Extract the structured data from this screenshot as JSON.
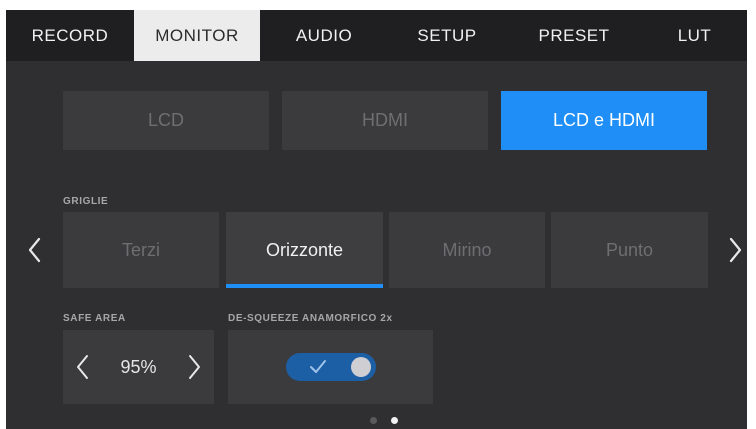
{
  "tabs": [
    {
      "label": "RECORD"
    },
    {
      "label": "MONITOR"
    },
    {
      "label": "AUDIO"
    },
    {
      "label": "SETUP"
    },
    {
      "label": "PRESET"
    },
    {
      "label": "LUT"
    }
  ],
  "active_tab": "MONITOR",
  "output": {
    "options": [
      {
        "label": "LCD"
      },
      {
        "label": "HDMI"
      },
      {
        "label": "LCD e HDMI"
      }
    ],
    "selected": "LCD e HDMI"
  },
  "grids": {
    "label": "GRIGLIE",
    "options": [
      {
        "label": "Terzi"
      },
      {
        "label": "Orizzonte"
      },
      {
        "label": "Mirino"
      },
      {
        "label": "Punto"
      }
    ],
    "selected": "Orizzonte"
  },
  "safe_area": {
    "label": "SAFE AREA",
    "value": "95%"
  },
  "desqueeze": {
    "label": "DE-SQUEEZE ANAMORFICO 2x",
    "enabled": true
  },
  "pager": {
    "pages": 2,
    "current": 2
  },
  "colors": {
    "accent": "#1f8ff7",
    "toggle_on": "#1d5fa4",
    "panel": "#2f2f31",
    "tabbar": "#1f1f21"
  },
  "icons": {
    "prev": "chevron-left-icon",
    "next": "chevron-right-icon",
    "check": "check-icon"
  }
}
